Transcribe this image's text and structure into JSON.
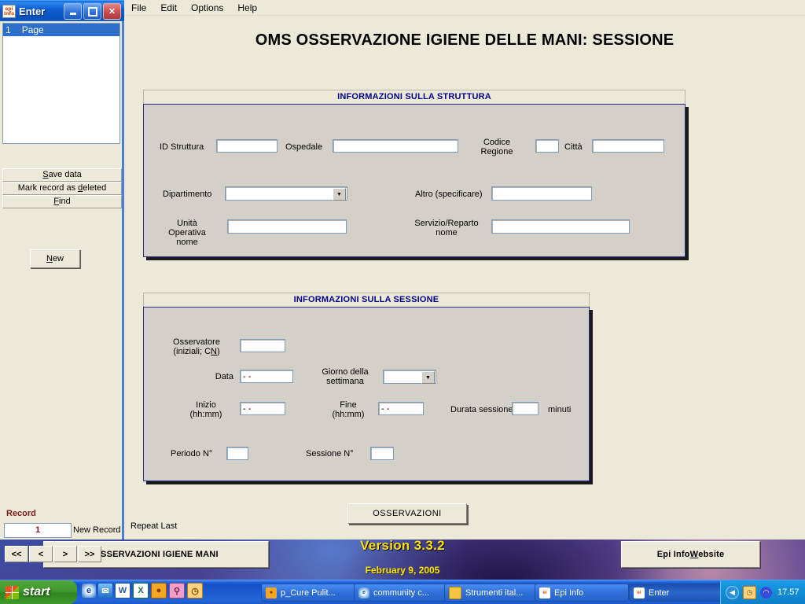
{
  "desktop": {
    "epi_info": {
      "version": "Version 3.3.2",
      "date": "February 9, 2005",
      "btn_observations": "OSSERVAZIONI IGIENE MANI",
      "btn_website": "Epi Info Website"
    }
  },
  "window": {
    "title": "Enter",
    "icon": "epiinfo-icon",
    "minimize": "–",
    "maximize": "□",
    "close": "✕"
  },
  "sidebar": {
    "pages": [
      {
        "number": "1",
        "label": "Page"
      }
    ],
    "buttons": {
      "save": "Save data",
      "save_accel": "S",
      "mark_deleted": "Mark record as deleted",
      "mark_accel": "d",
      "find": "Find",
      "find_accel": "F",
      "new": "New",
      "new_accel": "N"
    },
    "record": {
      "label": "Record",
      "value": "1",
      "status": "New Record",
      "nav_first": "<<",
      "nav_prev": "<",
      "nav_next": ">",
      "nav_last": ">>"
    }
  },
  "menu": {
    "items": [
      "File",
      "Edit",
      "Options",
      "Help"
    ]
  },
  "form": {
    "title": "OMS OSSERVAZIONE IGIENE DELLE MANI: SESSIONE",
    "structure_group": {
      "header": "INFORMAZIONI SULLA STRUTTURA",
      "fields": {
        "id_struttura_label": "ID Struttura",
        "id_struttura_value": "",
        "ospedale_label": "Ospedale",
        "ospedale_value": "",
        "codice_regione_label": "Codice Regione",
        "codice_regione_value": "",
        "citta_label": "Città",
        "citta_value": "",
        "dipartimento_label": "Dipartimento",
        "dipartimento_value": "",
        "altro_label": "Altro (specificare)",
        "altro_value": "",
        "unita_operativa_label": "Unità Operativa nome",
        "unita_operativa_value": "",
        "servizio_reparto_label": "Servizio/Reparto nome",
        "servizio_reparto_value": ""
      }
    },
    "session_group": {
      "header": "INFORMAZIONI SULLA SESSIONE",
      "fields": {
        "osservatore_label": "Osservatore (iniziali; CN)",
        "osservatore_accel": "N",
        "osservatore_value": "",
        "data_label": "Data",
        "data_value": " -  - ",
        "giorno_label": "Giorno della settimana",
        "giorno_value": "",
        "inizio_label": "Inizio (hh:mm)",
        "inizio_value": " -  - ",
        "fine_label": "Fine (hh:mm)",
        "fine_value": " -  - ",
        "durata_label": "Durata sessione",
        "durata_value": "",
        "durata_unit": "minuti",
        "periodo_label": "Periodo N°",
        "periodo_value": "",
        "sessione_label": "Sessione N°",
        "sessione_value": ""
      }
    },
    "repeat_last": "Repeat Last",
    "btn_osservazioni": "OSSERVAZIONI"
  },
  "taskbar": {
    "start": "start",
    "quicklaunch": [
      "ie-icon",
      "outlook-express-icon",
      "word-icon",
      "excel-icon",
      "clock-app-icon",
      "key-icon",
      "clock2-icon"
    ],
    "tasks": [
      {
        "label": "p_Cure Pulit...",
        "icon": "clock-app-icon",
        "active": false
      },
      {
        "label": "community c...",
        "icon": "ie-icon",
        "active": false
      },
      {
        "label": "Strumenti ital...",
        "icon": "folder-icon",
        "active": false
      },
      {
        "label": "Epi Info",
        "icon": "epiinfo-icon",
        "active": false
      },
      {
        "label": "Enter",
        "icon": "epiinfo-icon",
        "active": true
      }
    ],
    "clock": "17.57"
  },
  "colors": {
    "title_blue": "#00008b",
    "record_red": "#7b1a1a",
    "face": "#d4d0c8",
    "window_face": "#ece9d8",
    "epi_yellow": "#ffe000"
  }
}
